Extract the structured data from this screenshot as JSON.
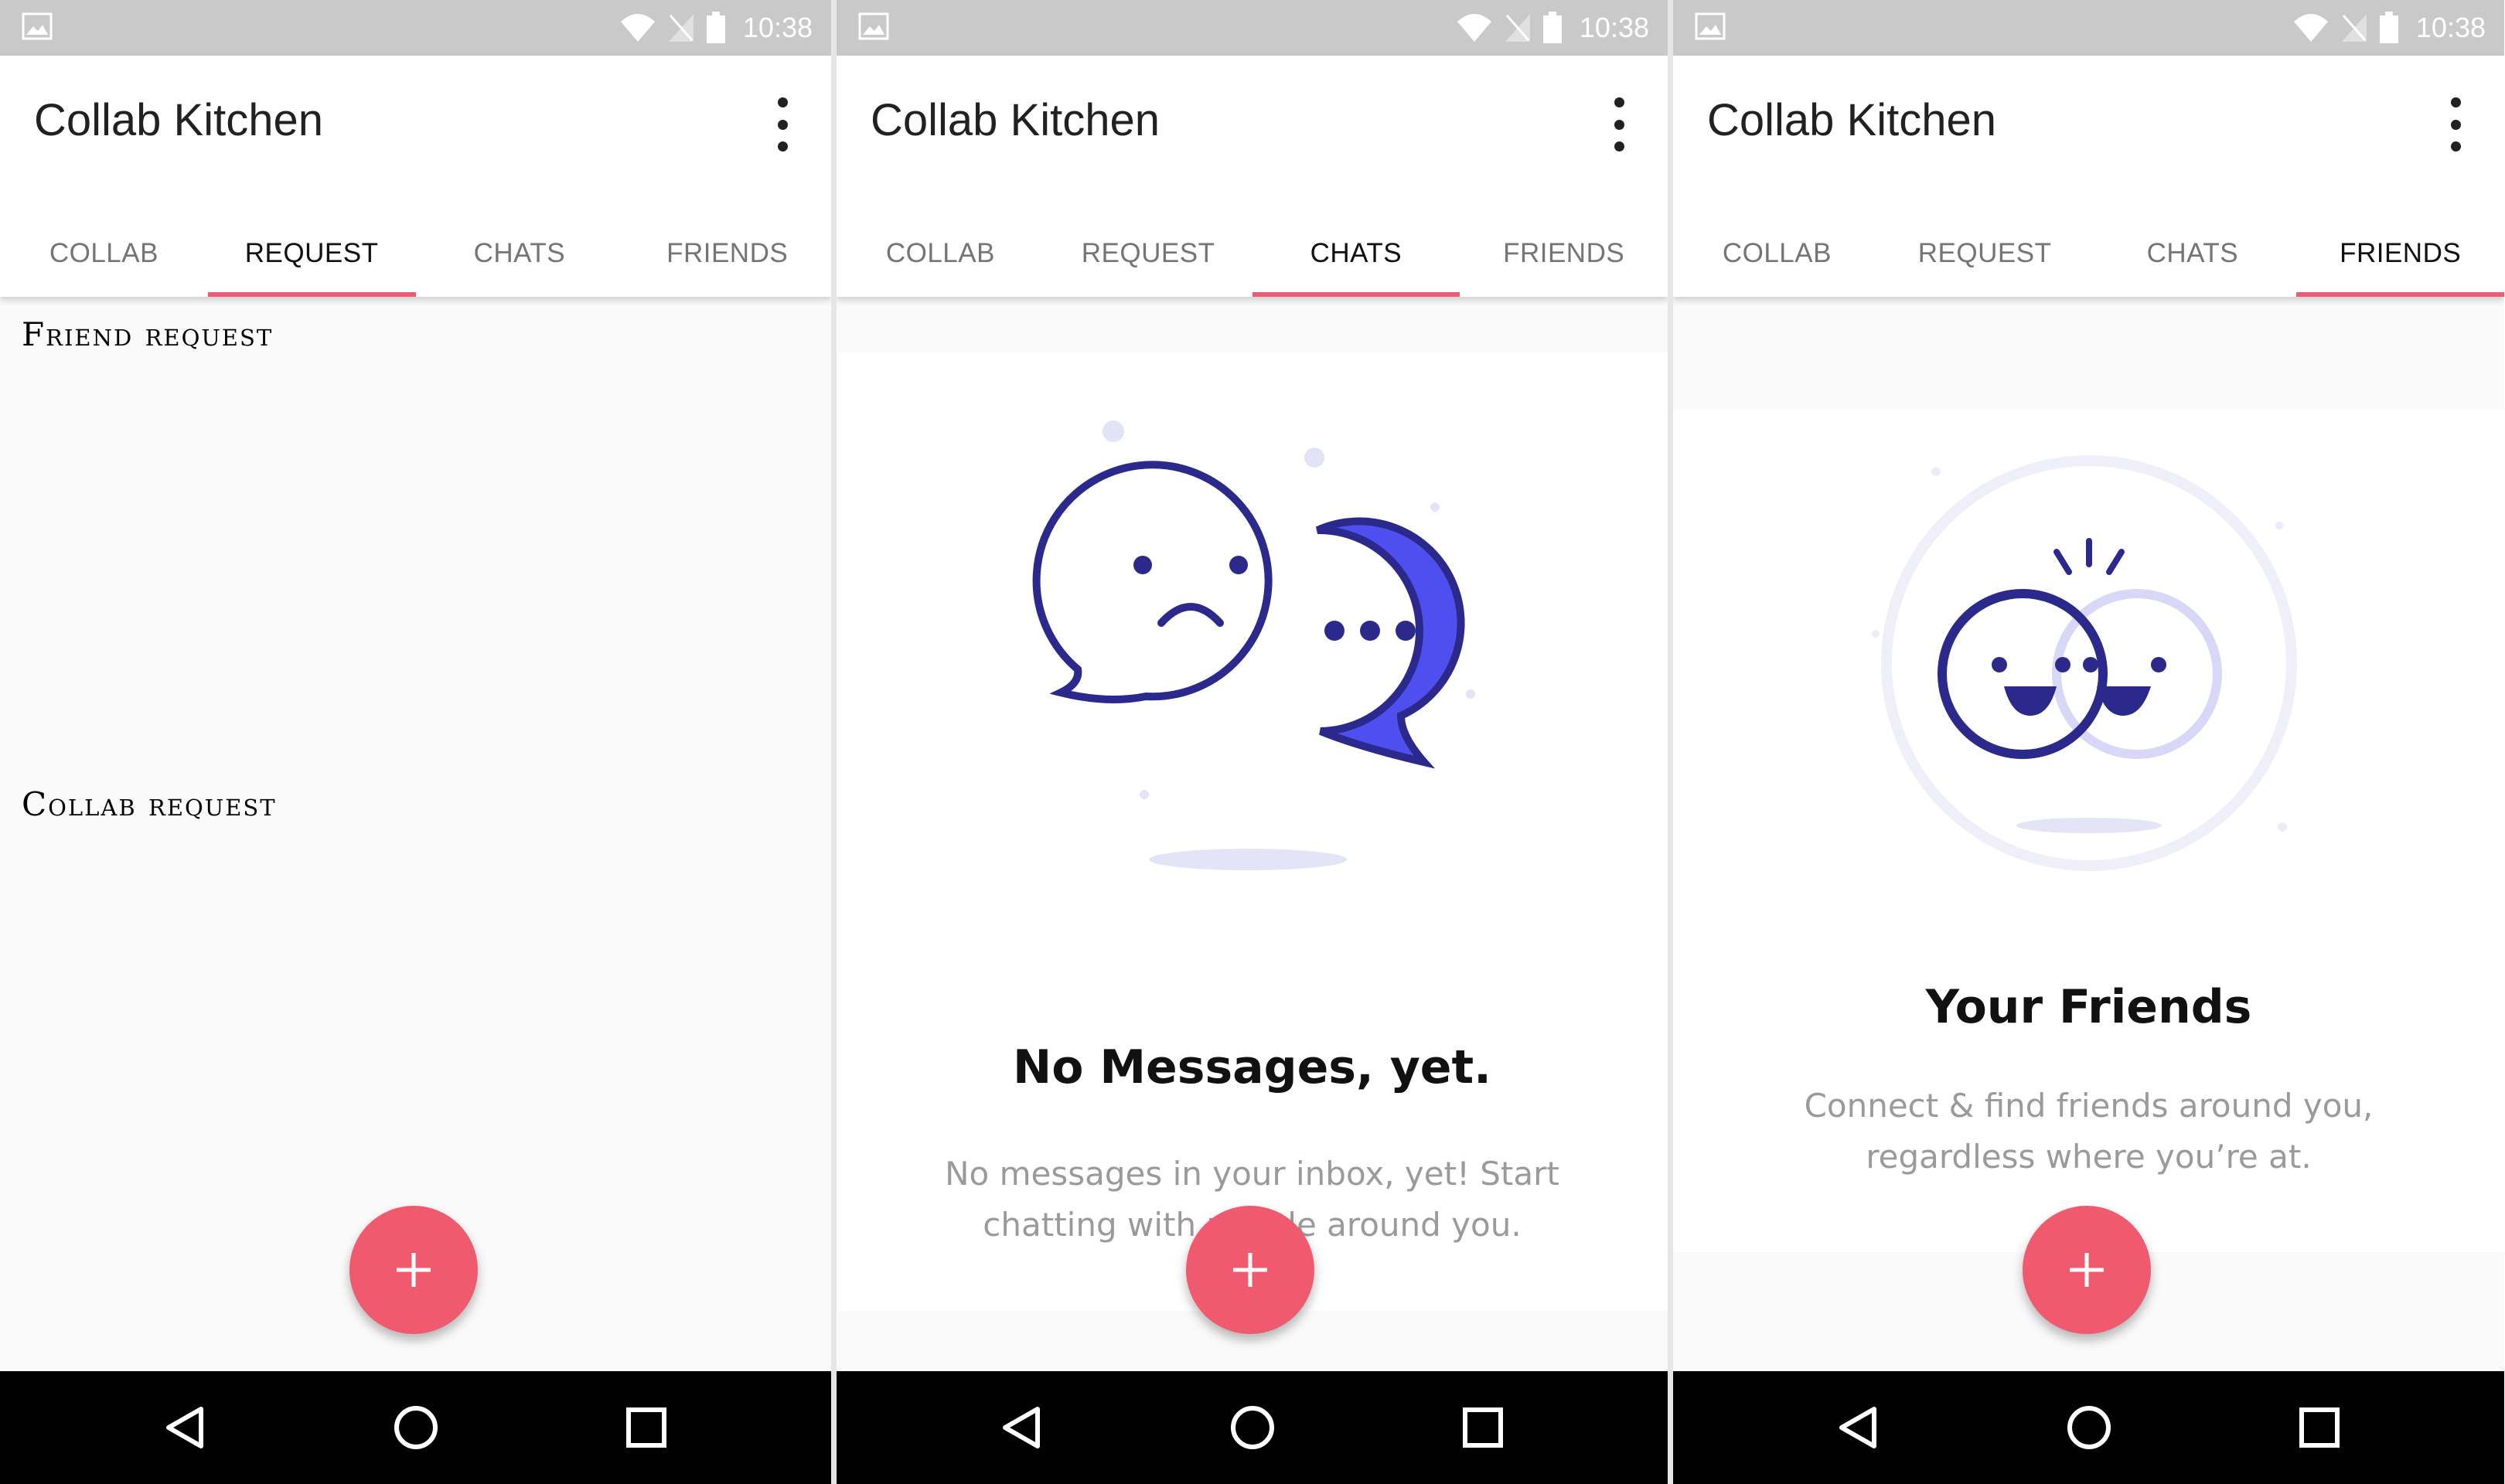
{
  "screens": [
    {
      "status": {
        "time": "10:38"
      },
      "app_title": "Collab Kitchen",
      "tabs": [
        "COLLAB",
        "REQUEST",
        "CHATS",
        "FRIENDS"
      ],
      "active_tab": "REQUEST",
      "sections": [
        "Friend request",
        "Collab request"
      ]
    },
    {
      "status": {
        "time": "10:38"
      },
      "app_title": "Collab Kitchen",
      "tabs": [
        "COLLAB",
        "REQUEST",
        "CHATS",
        "FRIENDS"
      ],
      "active_tab": "CHATS",
      "empty_state": {
        "title": "No Messages, yet.",
        "subtitle": "No messages in your inbox, yet! Start chatting with people around you."
      }
    },
    {
      "status": {
        "time": "10:38"
      },
      "app_title": "Collab Kitchen",
      "tabs": [
        "COLLAB",
        "REQUEST",
        "CHATS",
        "FRIENDS"
      ],
      "active_tab": "FRIENDS",
      "empty_state": {
        "title": "Your Friends",
        "subtitle": "Connect & find friends around you, regardless where you’re at."
      }
    }
  ],
  "colors": {
    "accent": "#ef5a74",
    "fab": "#ef5a6e",
    "illustration_dark": "#2b2a8c",
    "illustration_blue": "#4f4ff0",
    "status_bar": "#c9c9c9"
  },
  "icons": {
    "fab": "plus-icon",
    "nav": [
      "back-icon",
      "home-icon",
      "recents-icon"
    ],
    "status": [
      "image-notification-icon",
      "wifi-icon",
      "no-signal-icon",
      "battery-icon"
    ]
  }
}
